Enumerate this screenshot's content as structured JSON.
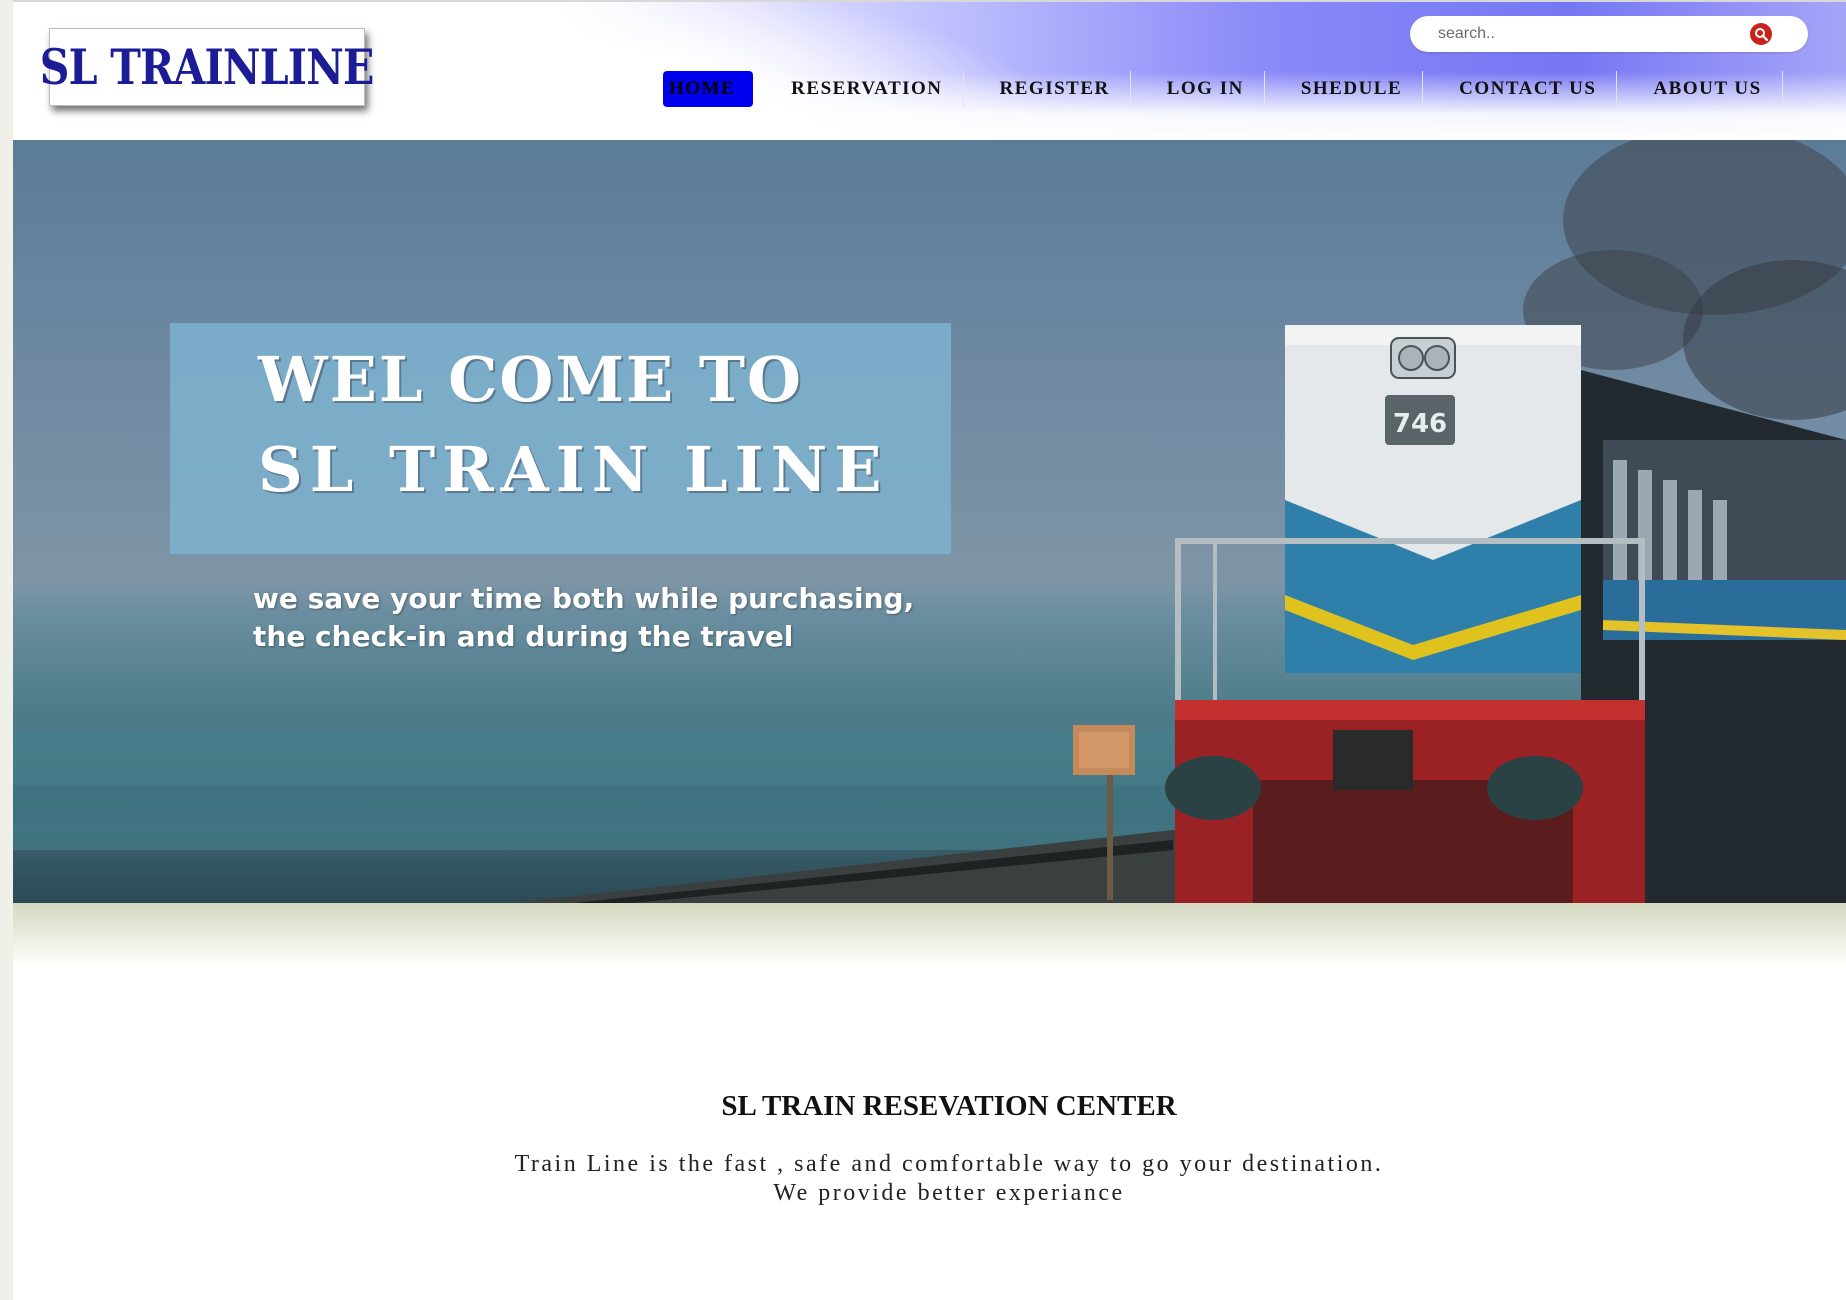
{
  "header": {
    "logo_text": "SL TRAINLINE",
    "search": {
      "placeholder": "search.."
    },
    "nav": [
      {
        "label": "HOME",
        "active": true
      },
      {
        "label": "RESERVATION",
        "active": false
      },
      {
        "label": "REGISTER",
        "active": false
      },
      {
        "label": "LOG IN",
        "active": false
      },
      {
        "label": "SHEDULE",
        "active": false
      },
      {
        "label": "CONTACT US",
        "active": false
      },
      {
        "label": "ABOUT US",
        "active": false
      }
    ]
  },
  "hero": {
    "title_line1": "WEL COME TO",
    "title_line2": "SL  TRAIN  LINE",
    "tagline_line1": "we save your time both while purchasing,",
    "tagline_line2": "the check-in and during the travel",
    "locomotive_number": "746"
  },
  "main": {
    "heading": "SL TRAIN RESEVATION CENTER",
    "text_line1": "Train Line is the fast , safe and comfortable way to go your destination.",
    "text_line2": "We provide better experiance"
  },
  "colors": {
    "logo_text": "#1c1c96",
    "nav_active_bg": "#0000ee",
    "header_gradient": "#7676f4",
    "search_button": "#c9221a"
  },
  "icons": {
    "search": "search-icon"
  }
}
